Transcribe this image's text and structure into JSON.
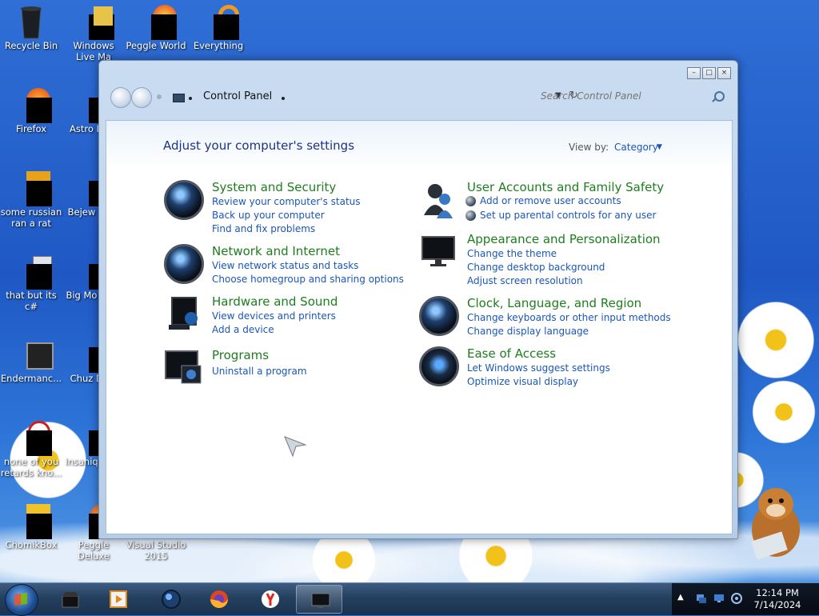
{
  "desktop": {
    "icons": [
      {
        "label": "Recycle Bin"
      },
      {
        "label": "Windows Live Ma"
      },
      {
        "label": "Peggle World"
      },
      {
        "label": "Everything"
      },
      {
        "label": "Firefox"
      },
      {
        "label": "Astro Delu"
      },
      {
        "label": "some russian ran a rat"
      },
      {
        "label": "Bejew Delu"
      },
      {
        "label": "that but its c#"
      },
      {
        "label": "Big Mo Delu"
      },
      {
        "label": "Endermanc..."
      },
      {
        "label": "Chuz Delu"
      },
      {
        "label": "none of you retards kno..."
      },
      {
        "label": "Insaniq Delu"
      },
      {
        "label": "ChomikBox"
      },
      {
        "label": "Peggle Deluxe"
      },
      {
        "label": "Visual Studio 2015"
      }
    ]
  },
  "window": {
    "buttons": {
      "minimize": "–",
      "maximize": "□",
      "close": "×"
    },
    "address": "Control Panel",
    "search_placeholder": "Search Control Panel",
    "heading": "Adjust your computer's settings",
    "view_by_label": "View by:",
    "view_by_value": "Category",
    "categories": [
      {
        "title": "System and Security",
        "links": [
          "Review your computer's status",
          "Back up your computer",
          "Find and fix problems"
        ]
      },
      {
        "title": "Network and Internet",
        "links": [
          "View network status and tasks",
          "Choose homegroup and sharing options"
        ]
      },
      {
        "title": "Hardware and Sound",
        "links": [
          "View devices and printers",
          "Add a device"
        ]
      },
      {
        "title": "Programs",
        "links": [
          "Uninstall a program"
        ]
      },
      {
        "title": "User Accounts and Family Safety",
        "links": [
          "Add or remove user accounts",
          "Set up parental controls for any user"
        ]
      },
      {
        "title": "Appearance and Personalization",
        "links": [
          "Change the theme",
          "Change desktop background",
          "Adjust screen resolution"
        ]
      },
      {
        "title": "Clock, Language, and Region",
        "links": [
          "Change keyboards or other input methods",
          "Change display language"
        ]
      },
      {
        "title": "Ease of Access",
        "links": [
          "Let Windows suggest settings",
          "Optimize visual display"
        ]
      }
    ]
  },
  "taskbar": {
    "apps": [
      "explorer-icon",
      "media-player-icon",
      "globe-icon",
      "firefox-icon",
      "yandex-icon",
      "control-panel-icon"
    ],
    "clock_time": "12:14 PM",
    "clock_date": "7/14/2024"
  },
  "colors": {
    "link": "#1a56b8",
    "category_title": "#1e7d1e",
    "heading": "#1e3287"
  }
}
